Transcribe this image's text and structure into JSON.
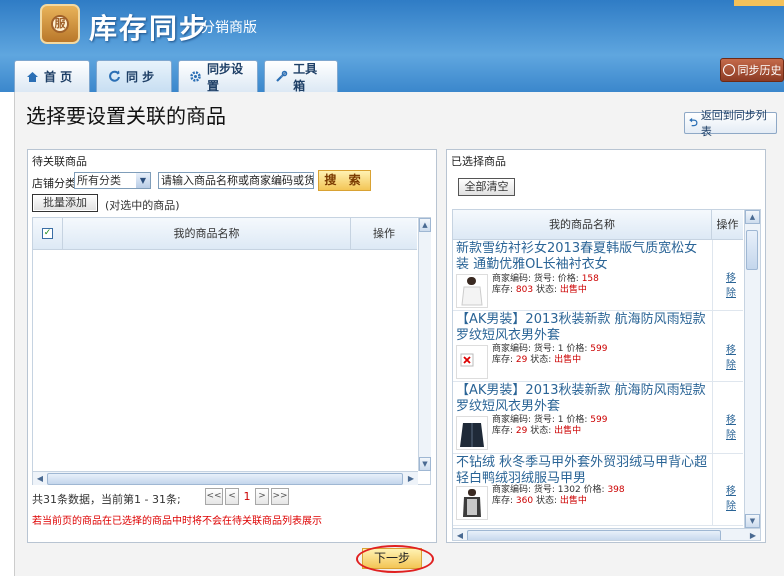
{
  "header": {
    "logo_char": "服",
    "app_title": "库存同步",
    "app_subtitle": "分销商版",
    "history_label": "同步历史"
  },
  "tabs": [
    {
      "label": "首 页",
      "icon": "home-icon"
    },
    {
      "label": "同 步",
      "icon": "sync-icon"
    },
    {
      "label": "同步设置",
      "icon": "gear-icon"
    },
    {
      "label": "工具箱",
      "icon": "tools-icon"
    }
  ],
  "page": {
    "title": "选择要设置关联的商品",
    "back_label": "返回到同步列表",
    "next_label": "下一步"
  },
  "left": {
    "panel_title": "待关联商品",
    "category_label": "店铺分类",
    "category_value": "所有分类",
    "search_value": "请输入商品名称或商家编码或货号",
    "search_button": "搜 索",
    "batch_button": "批量添加",
    "batch_note": "(对选中的商品)",
    "col_name": "我的商品名称",
    "col_action": "操作",
    "pager_info": "共31条数据，当前第1 - 31条;",
    "pager": {
      "first": "<<",
      "prev": "<",
      "current": "1",
      "next": ">",
      "last": ">>"
    },
    "notice": "若当前页的商品在已选择的商品中时将不会在待关联商品列表展示"
  },
  "right": {
    "panel_title": "已选择商品",
    "clear_button": "全部清空",
    "col_name": "我的商品名称",
    "col_action": "操作",
    "products": [
      {
        "name": "新款雪纺衬衫女2013春夏韩版气质宽松女装 通勤优雅OL长袖衬衣女",
        "meta1": "商家编码:  货号:  价格: ",
        "price": "158",
        "meta2": "库存: ",
        "stock": "803",
        "status_label": " 状态: ",
        "status": "出售中",
        "remove": "移除",
        "thumb": "white-shirt-image"
      },
      {
        "name": "【AK男装】2013秋装新款 航海防风雨短款罗纹短风衣男外套",
        "meta1": "商家编码:  货号: 1 价格: ",
        "price": "599",
        "meta2": "库存: ",
        "stock": "29",
        "status_label": " 状态: ",
        "status": "出售中",
        "remove": "移除",
        "thumb": "broken-image-icon"
      },
      {
        "name": "【AK男装】2013秋装新款 航海防风雨短款罗纹短风衣男外套",
        "meta1": "商家编码:  货号: 1 价格: ",
        "price": "599",
        "meta2": "库存: ",
        "stock": "29",
        "status_label": " 状态: ",
        "status": "出售中",
        "remove": "移除",
        "thumb": "dark-jacket-image"
      },
      {
        "name": "不钻绒 秋冬季马甲外套外贸羽绒马甲背心超轻白鸭绒羽绒服马甲男",
        "meta1": "商家编码:  货号: 1302 价格: ",
        "price": "398",
        "meta2": "库存: ",
        "stock": "360",
        "status_label": " 状态: ",
        "status": "出售中",
        "remove": "移除",
        "thumb": "vest-image"
      }
    ]
  }
}
